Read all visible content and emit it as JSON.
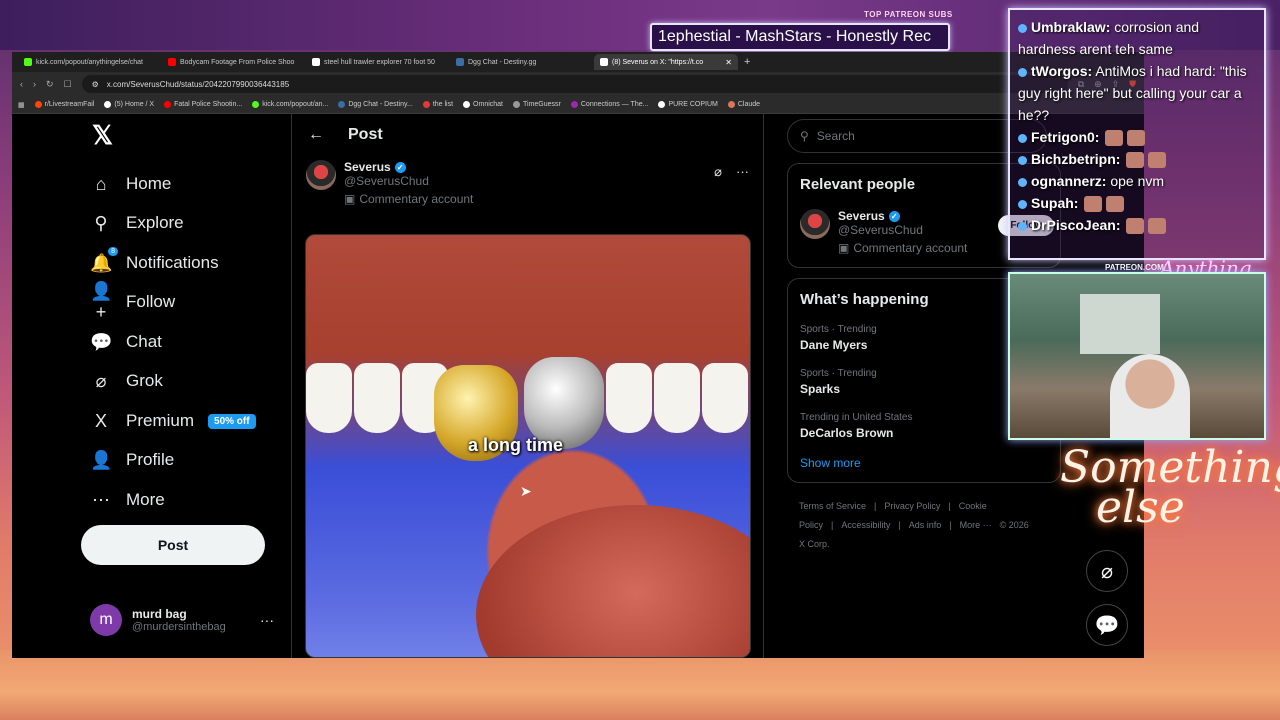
{
  "overlay": {
    "patreon_top": "TOP PATREON SUBS",
    "ticker": "1ephestial - MashStars - Honestly Rec",
    "patreon_bottom": "PATREON.COM/",
    "brand_script": "Anything else",
    "something_else_l1": "Something",
    "something_else_l2": "else",
    "chat": [
      {
        "user": "Umbraklaw:",
        "msg": "corrosion and hardness arent teh same"
      },
      {
        "user": "tWorgos:",
        "msg": "AntiMos i had hard: \"this guy right here\" but calling your car a he??"
      },
      {
        "user": "Fetrigon0:",
        "msg": ""
      },
      {
        "user": "Bichzbetripn:",
        "msg": ""
      },
      {
        "user": "ognannerz:",
        "msg": "ope nvm"
      },
      {
        "user": "Supah:",
        "msg": ""
      },
      {
        "user": "DrPiscoJean:",
        "msg": ""
      }
    ]
  },
  "browser": {
    "tabs": [
      {
        "title": "kick.com/popout/anythingelse/chat",
        "color": "#53fc18"
      },
      {
        "title": "Bodycam Footage From Police Shoo",
        "color": "#ff0000"
      },
      {
        "title": "steel hull trawler explorer 70 foot 50",
        "color": "#ffffff"
      },
      {
        "title": "Dgg Chat - Destiny.gg",
        "color": "#3a6ea5"
      },
      {
        "title": "(8) Severus on X: \"https://t.co",
        "color": "#ffffff",
        "active": true
      }
    ],
    "url": "x.com/SeverusChud/status/2042207990036443185",
    "bookmarks": [
      {
        "title": "r/LivestreamFail",
        "color": "#ff4500"
      },
      {
        "title": "(5) Home / X",
        "color": "#ffffff"
      },
      {
        "title": "Fatal Police Shootin...",
        "color": "#ff0000"
      },
      {
        "title": "kick.com/popout/an...",
        "color": "#53fc18"
      },
      {
        "title": "Dgg Chat - Destiny...",
        "color": "#3a6ea5"
      },
      {
        "title": "the list",
        "color": "#e53935"
      },
      {
        "title": "Omnichat",
        "color": "#ffffff"
      },
      {
        "title": "TimeGuessr",
        "color": "#999999"
      },
      {
        "title": "Connections — The...",
        "color": "#9c27b0"
      },
      {
        "title": "PURE COPIUM",
        "color": "#ffffff"
      },
      {
        "title": "Claude",
        "color": "#d97757"
      }
    ]
  },
  "nav": {
    "items": [
      {
        "label": "Home",
        "icon": "⌂"
      },
      {
        "label": "Explore",
        "icon": "⚲"
      },
      {
        "label": "Notifications",
        "icon": "🔔",
        "badge": "8"
      },
      {
        "label": "Follow",
        "icon": "👤+"
      },
      {
        "label": "Chat",
        "icon": "💬"
      },
      {
        "label": "Grok",
        "icon": "⌀"
      },
      {
        "label": "Premium",
        "icon": "X",
        "badge_text": "50% off"
      },
      {
        "label": "Profile",
        "icon": "👤"
      },
      {
        "label": "More",
        "icon": "⋯"
      }
    ],
    "post_button": "Post",
    "account_initial": "m",
    "account_name": "murd bag",
    "account_handle": "@murdersinthebag"
  },
  "post": {
    "header": "Post",
    "author_name": "Severus",
    "author_handle": "@SeverusChud",
    "author_tag": "Commentary account",
    "video_caption": "a long time"
  },
  "sidebar": {
    "search_placeholder": "Search",
    "relevant_title": "Relevant people",
    "relevant_name": "Severus",
    "relevant_handle": "@SeverusChud",
    "relevant_tag": "Commentary account",
    "follow_label": "Follow",
    "happening_title": "What’s happening",
    "trends": [
      {
        "meta": "Sports · Trending",
        "name": "Dane Myers"
      },
      {
        "meta": "Sports · Trending",
        "name": "Sparks"
      },
      {
        "meta": "Trending in United States",
        "name": "DeCarlos Brown"
      }
    ],
    "show_more": "Show more",
    "footer": [
      "Terms of Service",
      "|",
      "Privacy Policy",
      "|",
      "Cookie Policy",
      "|",
      "Accessibility",
      "|",
      "Ads info",
      "|",
      "More ···",
      "© 2026 X Corp."
    ]
  }
}
